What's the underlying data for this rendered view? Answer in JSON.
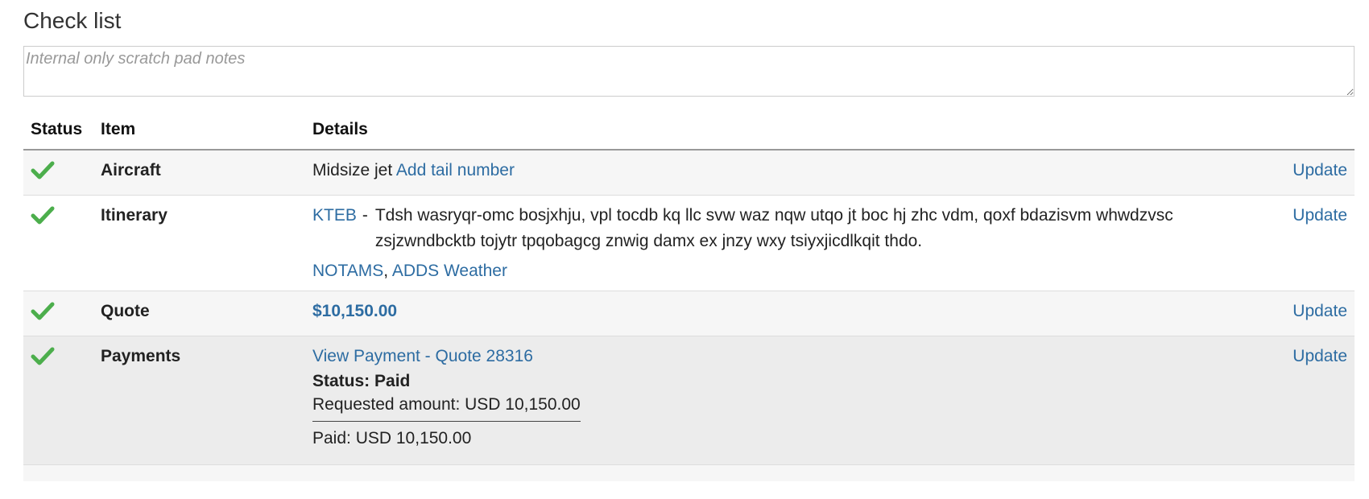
{
  "checklist": {
    "title": "Check list",
    "notes": {
      "placeholder": "Internal only scratch pad notes",
      "value": ""
    }
  },
  "table": {
    "headers": {
      "status": "Status",
      "item": "Item",
      "details": "Details"
    },
    "update_label": "Update",
    "rows": {
      "aircraft": {
        "status": "check",
        "item": "Aircraft",
        "detail_text": "Midsize jet",
        "link": "Add tail number"
      },
      "itinerary": {
        "status": "check",
        "item": "Itinerary",
        "airport": "KTEB",
        "dash": "-",
        "description": "Tdsh wasryqr-omc bosjxhju, vpl tocdb kq llc svw waz nqw utqo jt boc hj zhc vdm, qoxf bdazisvm whwdzvsc zsjzwndbcktb tojytr tpqobagcg znwig damx ex jnzy wxy tsiyxjicdlkqit thdo.",
        "link_notams": "NOTAMS",
        "separator": ",",
        "link_weather": "ADDS Weather"
      },
      "quote": {
        "status": "check",
        "item": "Quote",
        "amount": "$10,150.00"
      },
      "payments": {
        "status": "check",
        "item": "Payments",
        "link": "View Payment - Quote 28316",
        "status_text": "Status: Paid",
        "requested": "Requested amount: USD 10,150.00",
        "paid": "Paid: USD 10,150.00"
      }
    }
  },
  "colors": {
    "link": "#2d6ca2",
    "check": "#4cae4c",
    "row_alt": "#f6f6f6",
    "row_highlight": "#ececec"
  }
}
